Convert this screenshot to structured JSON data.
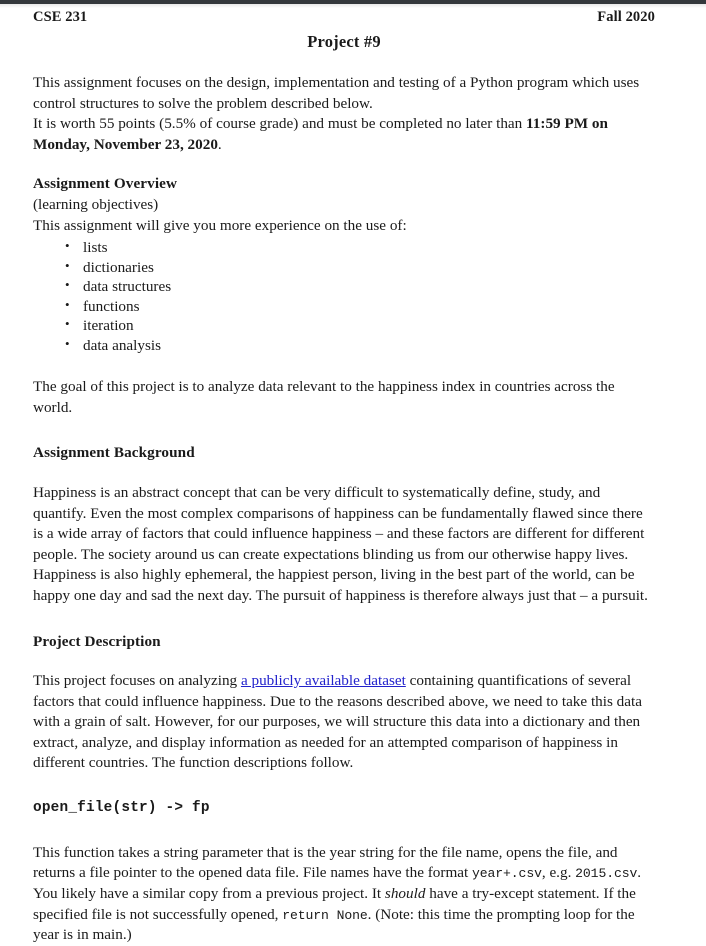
{
  "header": {
    "course_code": "CSE 231",
    "term": "Fall 2020",
    "title": "Project #9"
  },
  "intro": {
    "line1": "This assignment focuses on the design, implementation and testing of a Python program which uses control structures to solve the problem described below.",
    "line2_prefix": "It is worth 55 points (5.5% of course grade) and must be completed no later than ",
    "line2_due_bold": "11:59 PM on Monday, November 23, 2020",
    "line2_suffix": "."
  },
  "overview": {
    "heading": "Assignment Overview",
    "subtitle": "(learning objectives)",
    "lead": "This assignment will give you more experience on the use of:",
    "objectives": [
      "lists",
      "dictionaries",
      "data structures",
      "functions",
      "iteration",
      "data analysis"
    ],
    "goal": "The goal of this project is to analyze data relevant to the happiness index in countries across the world."
  },
  "background": {
    "heading": "Assignment Background",
    "body": "Happiness is an abstract concept that can be very difficult to systematically define, study, and quantify. Even the most complex comparisons of happiness can be fundamentally flawed since there is a wide array of factors that could influence happiness – and these factors are different for different people. The society around us can create expectations blinding us from our otherwise happy lives. Happiness is also highly ephemeral, the happiest person, living in the best part of the world, can be happy one day and sad the next day. The pursuit of happiness is therefore always just that – a pursuit."
  },
  "description": {
    "heading": "Project Description",
    "body_part1": "This project focuses on analyzing ",
    "link_text": "a publicly available dataset",
    "body_part2": " containing quantifications of several factors that could influence happiness. Due to the reasons described above, we need to take this data with a grain of salt. However, for our purposes, we will structure this data into a dictionary and then extract, analyze, and display information as needed for an attempted comparison of happiness in different countries. The function descriptions follow."
  },
  "function": {
    "signature": "open_file(str) -> fp",
    "desc_part1": "This function takes a string parameter that is the year string for the file name, opens the file, and returns a file pointer to the opened data file.  File names have the format ",
    "code_format": "year+.csv",
    "desc_part2": ", e.g. ",
    "code_example": "2015.csv",
    "desc_part3": ". You likely have a similar copy from a previous project.  It ",
    "emphasis": "should",
    "desc_part4": " have a try-except statement.  If the specified file is not successfully opened, ",
    "code_return": "return None",
    "desc_part5": ". (Note: this time the prompting loop for the year is in main.)"
  },
  "colors": {
    "link": "#2222CC",
    "text": "#1A1A1A",
    "chrome_bar": "#34383C"
  }
}
